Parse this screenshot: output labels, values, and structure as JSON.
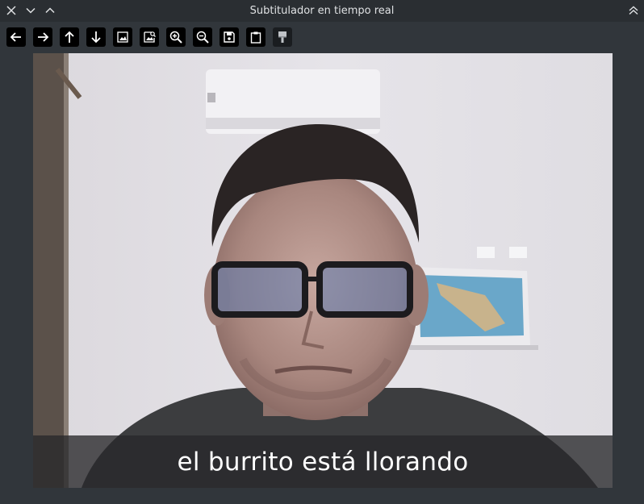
{
  "window": {
    "title": "Subtitulador en tiempo real",
    "controls": {
      "close_icon": "close-icon",
      "minimize_icon": "chevron-down-icon",
      "maximize_icon": "chevron-up-icon",
      "keep_above_icon": "double-chevron-up-icon"
    }
  },
  "toolbar": {
    "tools": [
      {
        "icon": "arrow-left-icon",
        "enabled": true
      },
      {
        "icon": "arrow-right-icon",
        "enabled": true
      },
      {
        "icon": "arrow-up-icon",
        "enabled": true
      },
      {
        "icon": "arrow-down-icon",
        "enabled": true
      },
      {
        "icon": "image-icon",
        "enabled": true
      },
      {
        "icon": "image-search-icon",
        "enabled": true
      },
      {
        "icon": "zoom-in-icon",
        "enabled": true
      },
      {
        "icon": "zoom-out-icon",
        "enabled": true
      },
      {
        "icon": "save-icon",
        "enabled": true
      },
      {
        "icon": "clipboard-icon",
        "enabled": true
      },
      {
        "icon": "paint-brush-icon",
        "enabled": false
      }
    ]
  },
  "video": {
    "subtitle": "el burrito está llorando"
  }
}
